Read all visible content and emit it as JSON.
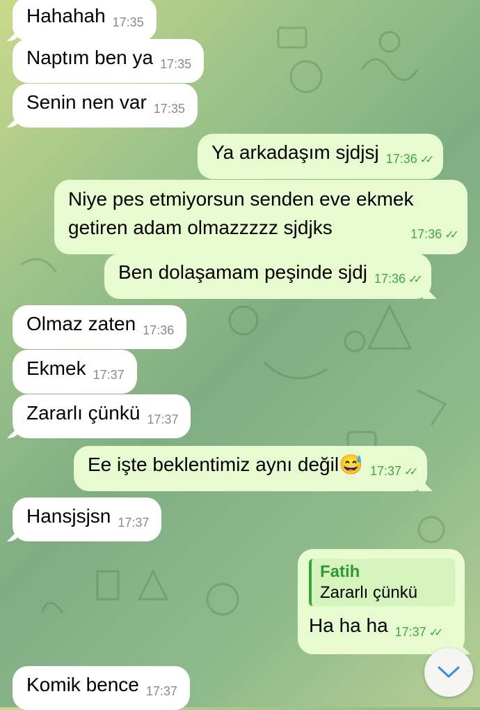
{
  "colors": {
    "outgoing_bubble": "#e8fbd0",
    "incoming_bubble": "#ffffff",
    "check": "#3fa745",
    "reply_accent": "#37a43a"
  },
  "messages": [
    {
      "text": "Hahahah",
      "time": "17:35"
    },
    {
      "text": "Naptım ben ya",
      "time": "17:35"
    },
    {
      "text": "Senin nen var",
      "time": "17:35"
    },
    {
      "text": "Ya arkadaşım sjdjsj",
      "time": "17:36",
      "status": "read"
    },
    {
      "line1": "Niye pes etmiyorsun senden eve ekmek",
      "line2": "getiren adam olmazzzzz sjdjks",
      "time": "17:36",
      "status": "read"
    },
    {
      "text": "Ben dolaşamam peşinde sjdj",
      "time": "17:36",
      "status": "read"
    },
    {
      "text": "Olmaz zaten",
      "time": "17:36"
    },
    {
      "text": "Ekmek",
      "time": "17:37"
    },
    {
      "text": "Zararlı çünkü",
      "time": "17:37"
    },
    {
      "text": "Ee işte beklentimiz aynı değil",
      "emoji": "😅",
      "time": "17:37",
      "status": "read"
    },
    {
      "text": "Hansjsjsn",
      "time": "17:37"
    },
    {
      "reply_name": "Fatih",
      "reply_text": "Zararlı çünkü",
      "text": "Ha ha ha",
      "time": "17:37",
      "status": "read"
    },
    {
      "text": "Komik bence",
      "time": "17:37"
    }
  ],
  "icons": {
    "read": "double-check-icon",
    "scroll": "chevron-down-icon"
  }
}
